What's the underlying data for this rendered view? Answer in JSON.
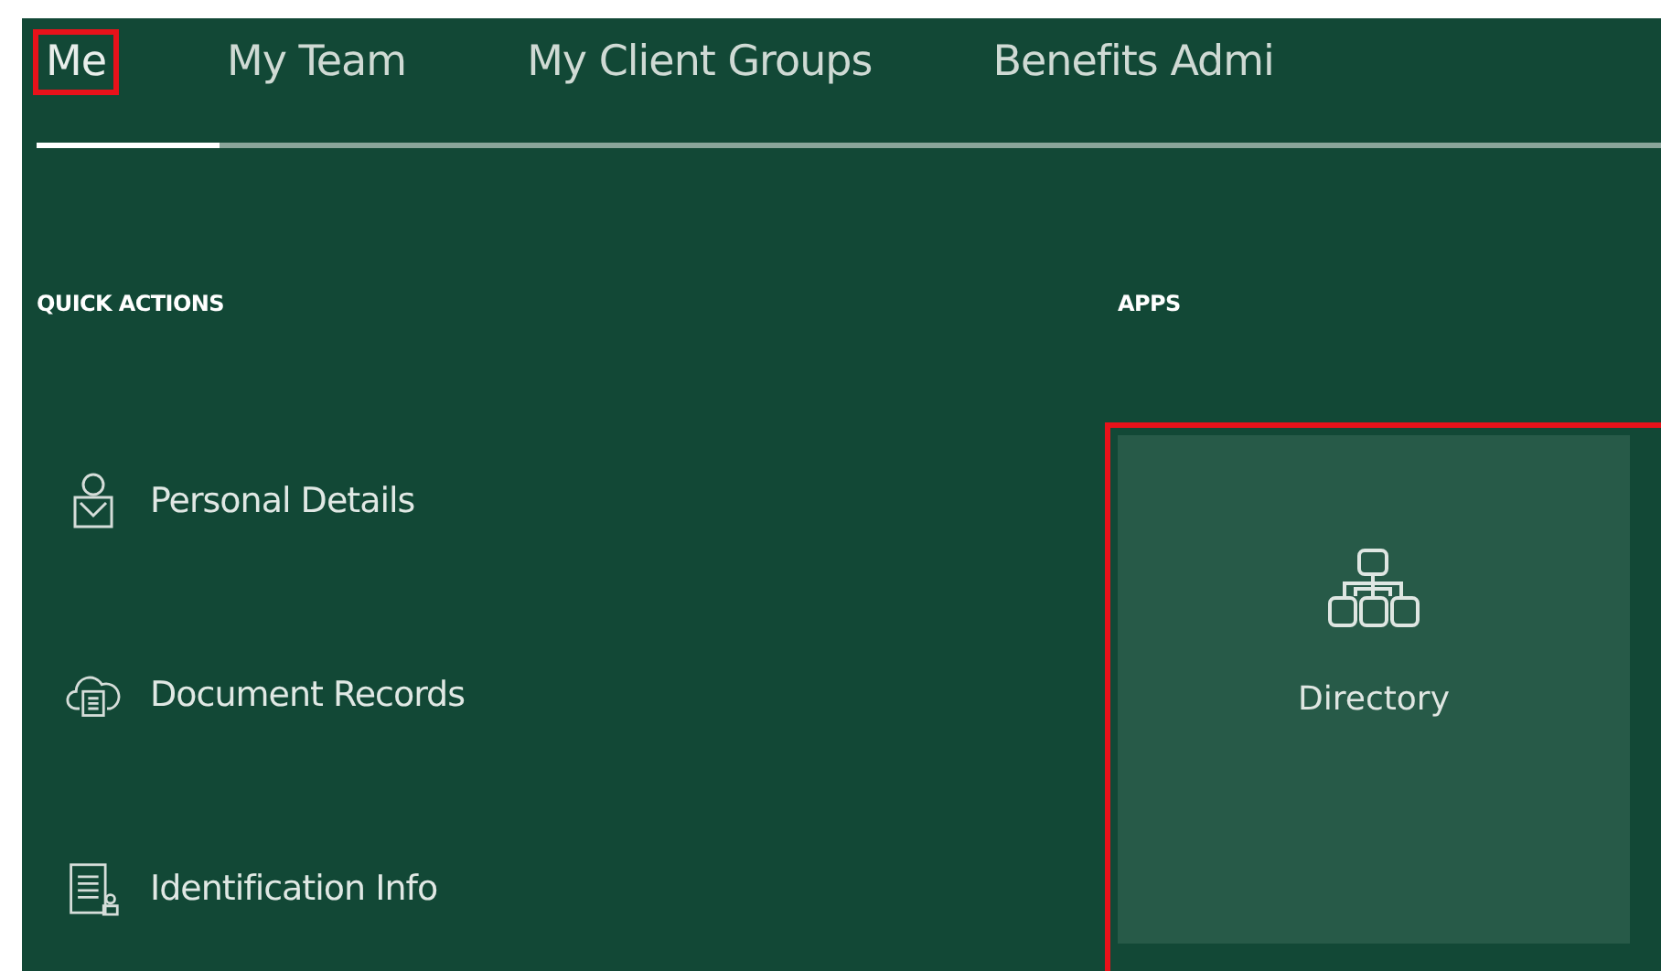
{
  "tabs": [
    {
      "label": "Me",
      "selected": true,
      "highlighted": true
    },
    {
      "label": "My Team",
      "selected": false,
      "highlighted": false
    },
    {
      "label": "My Client Groups",
      "selected": false,
      "highlighted": false
    },
    {
      "label": "Benefits Admi",
      "selected": false,
      "highlighted": false
    }
  ],
  "quick_actions": {
    "title": "QUICK ACTIONS",
    "items": [
      {
        "label": "Personal Details",
        "kind": "person"
      },
      {
        "label": "Document Records",
        "kind": "cloud-document"
      },
      {
        "label": "Identification Info",
        "kind": "id-document"
      }
    ]
  },
  "apps": {
    "title": "APPS",
    "tiles": [
      {
        "label": "Directory",
        "kind": "org-chart",
        "highlighted": true
      }
    ]
  }
}
